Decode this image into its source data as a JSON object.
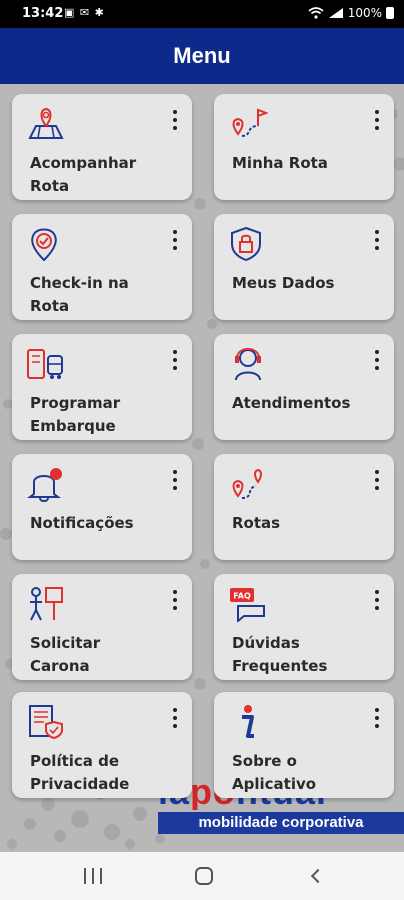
{
  "status_bar": {
    "time": "13:42",
    "left_icons": "▣ ✉ ✱",
    "battery": "100%",
    "signal_icons": [
      "wifi-icon",
      "signal-icon"
    ]
  },
  "app_bar": {
    "title": "Menu",
    "color": "#0d2a8a"
  },
  "menu": {
    "items": [
      {
        "label": "Acompanhar\nRota",
        "icon": "map-location-icon"
      },
      {
        "label": "Minha Rota",
        "icon": "route-flag-icon"
      },
      {
        "label": "Check-in na\nRota",
        "icon": "location-check-icon"
      },
      {
        "label": "Meus Dados",
        "icon": "shield-lock-icon"
      },
      {
        "label": "Programar\nEmbarque",
        "icon": "ticket-bus-icon"
      },
      {
        "label": "Atendimentos",
        "icon": "headset-agent-icon"
      },
      {
        "label": "Notificações",
        "icon": "bell-icon"
      },
      {
        "label": "Rotas",
        "icon": "routes-icon"
      },
      {
        "label": "Solicitar\nCarona",
        "icon": "hitchhike-sign-icon"
      },
      {
        "label": "Dúvidas\nFrequentes",
        "icon": "faq-bubble-icon"
      },
      {
        "label": "Política de\nPrivacidade",
        "icon": "privacy-document-icon"
      },
      {
        "label": "Sobre o\nAplicativo",
        "icon": "info-icon"
      }
    ],
    "more_icon": "more-vertical-icon",
    "card_color": "#e6e6e6",
    "icon_blue": "#1f3a93",
    "icon_red": "#e03030"
  },
  "logo": {
    "brand_partial_blue": "la",
    "brand_partial_red": "po",
    "brand_partial_rest": "ntual",
    "tagline": "mobilidade corporativa"
  },
  "nav_bar": {
    "buttons": [
      "recents-icon",
      "home-icon",
      "back-icon"
    ]
  }
}
